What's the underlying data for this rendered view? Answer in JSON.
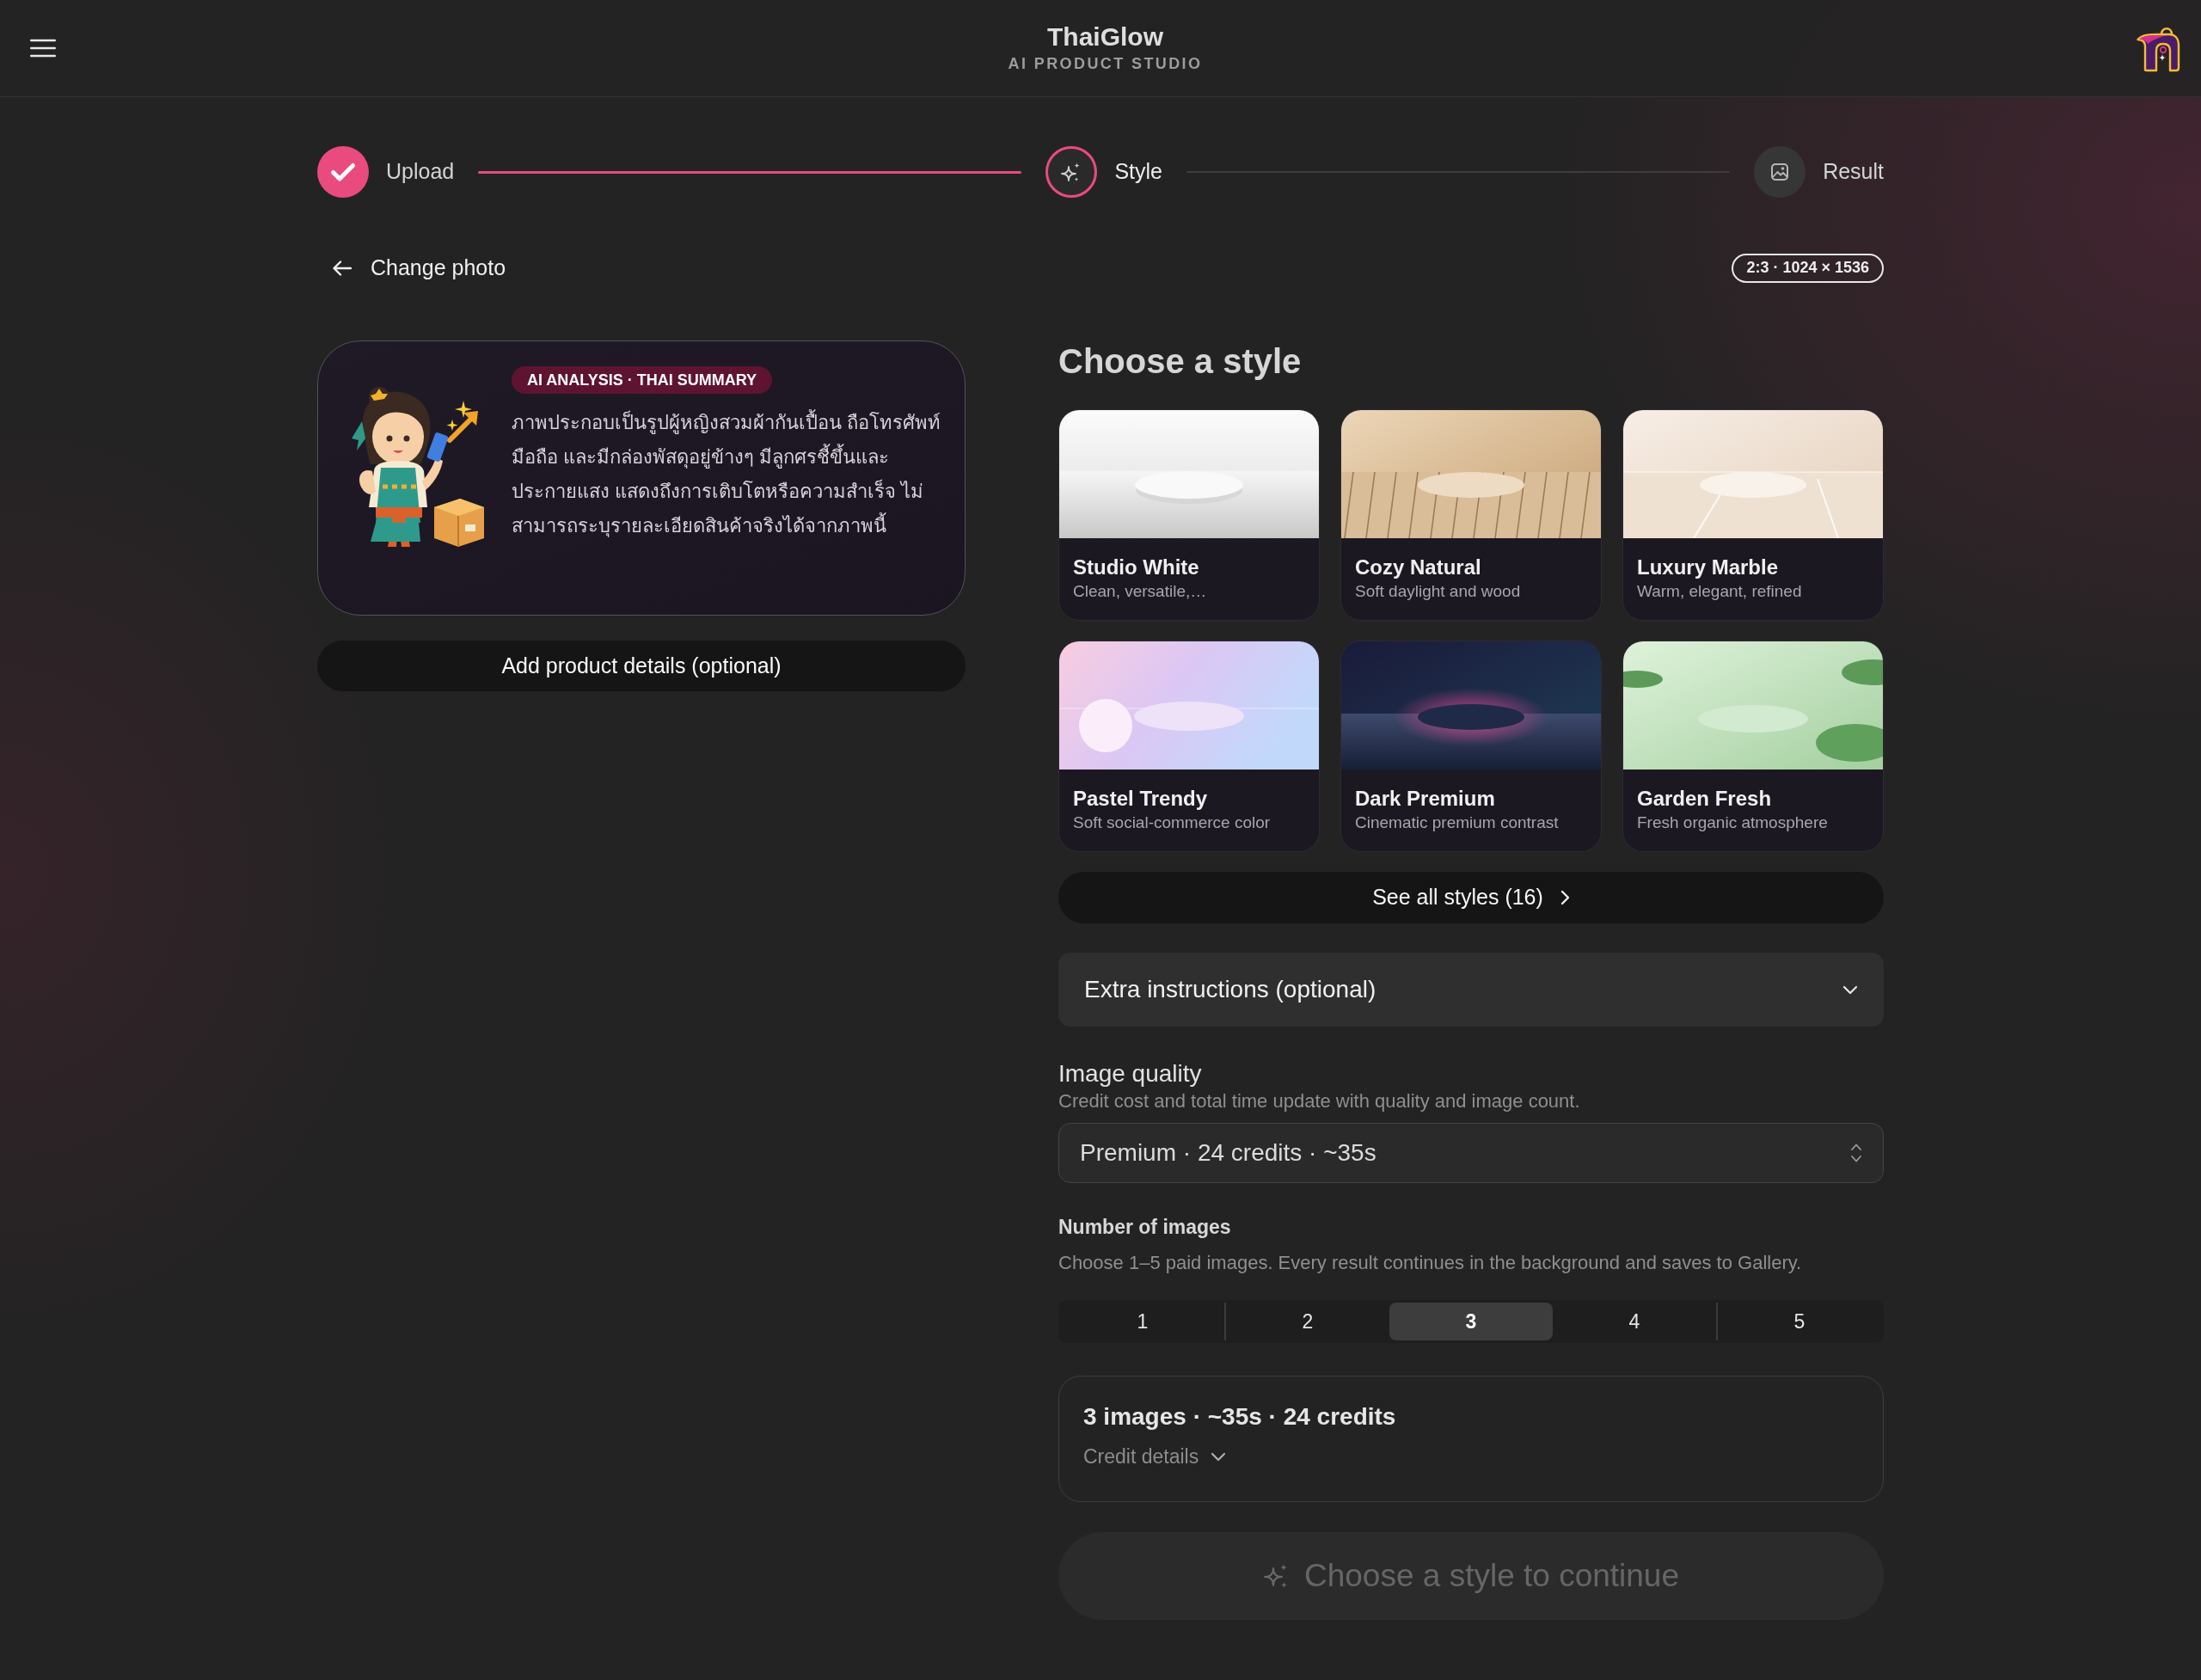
{
  "header": {
    "title": "ThaiGlow",
    "subtitle": "AI PRODUCT STUDIO"
  },
  "stepper": [
    {
      "label": "Upload",
      "kind": "upload",
      "completed": true,
      "active": false
    },
    {
      "label": "Style",
      "kind": "style",
      "completed": false,
      "active": true
    },
    {
      "label": "Result",
      "kind": "result",
      "completed": false,
      "active": false
    }
  ],
  "back_link": {
    "label": "Change photo"
  },
  "size_badge": "2:3 · 1024 × 1536",
  "analysis_card": {
    "badge": "AI ANALYSIS · THAI SUMMARY",
    "summary": "ภาพประกอบเป็นรูปผู้หญิงสวมผ้ากันเปื้อน ถือโทรศัพท์มือถือ และมีกล่องพัสดุอยู่ข้างๆ มีลูกศรชี้ขึ้นและประกายแสง แสดงถึงการเติบโตหรือความสำเร็จ ไม่สามารถระบุรายละเอียดสินค้าจริงได้จากภาพนี้"
  },
  "details_button": {
    "label": "Add product details (optional)"
  },
  "style_section": {
    "title": "Choose a style",
    "styles": [
      {
        "name": "Studio White",
        "description": "Clean, versatile,…",
        "kind": "studio",
        "selected": false
      },
      {
        "name": "Cozy Natural",
        "description": "Soft daylight and wood",
        "kind": "wood",
        "selected": false
      },
      {
        "name": "Luxury Marble",
        "description": "Warm, elegant, refined",
        "kind": "marble",
        "selected": false
      },
      {
        "name": "Pastel Trendy",
        "description": "Soft social-commerce color",
        "kind": "pastel",
        "selected": false
      },
      {
        "name": "Dark Premium",
        "description": "Cinematic premium contrast",
        "kind": "dark",
        "selected": false
      },
      {
        "name": "Garden Fresh",
        "description": "Fresh organic atmosphere",
        "kind": "garden",
        "selected": false
      }
    ],
    "see_all": "See all styles (16)"
  },
  "extra_instructions": {
    "label": "Extra instructions (optional)",
    "expanded": false
  },
  "quality": {
    "label": "Image quality",
    "help": "Credit cost and total time update with quality and image count.",
    "value": "Premium · 24 credits · ~35s"
  },
  "image_count": {
    "label": "Number of images",
    "help": "Choose 1–5 paid images. Every result continues in the background and saves to Gallery.",
    "options": [
      {
        "label": "1",
        "selected": false
      },
      {
        "label": "2",
        "selected": false
      },
      {
        "label": "3",
        "selected": true
      },
      {
        "label": "4",
        "selected": false
      },
      {
        "label": "5",
        "selected": false
      }
    ]
  },
  "summary": {
    "text": "3 images · ~35s · 24 credits",
    "details_label": "Credit details",
    "expanded": false
  },
  "continue_button": {
    "label": "Choose a style to continue",
    "disabled": true
  }
}
